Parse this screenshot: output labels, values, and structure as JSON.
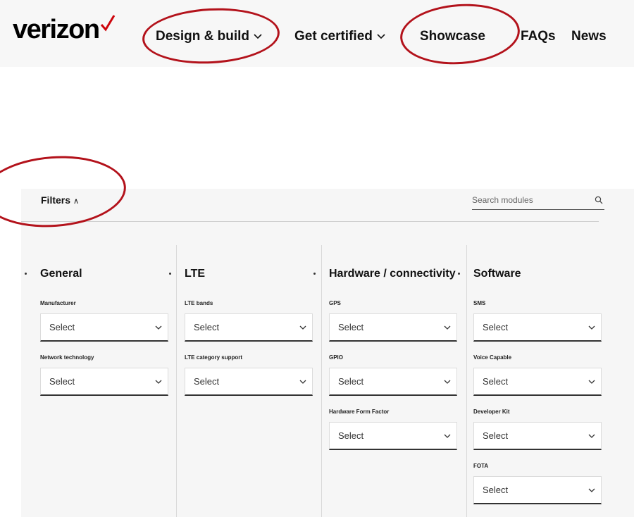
{
  "header": {
    "logo_text": "verizon",
    "nav": [
      {
        "label": "Design & build",
        "has_dropdown": true
      },
      {
        "label": "Get certified",
        "has_dropdown": true
      },
      {
        "label": "Showcase",
        "has_dropdown": false
      },
      {
        "label": "FAQs",
        "has_dropdown": false
      },
      {
        "label": "News",
        "has_dropdown": false
      }
    ]
  },
  "filters": {
    "toggle_label": "Filters",
    "search": {
      "placeholder": "Search modules",
      "value": ""
    },
    "columns": [
      {
        "title": "General",
        "fields": [
          {
            "label": "Manufacturer",
            "value": "Select"
          },
          {
            "label": "Network technology",
            "value": "Select"
          }
        ]
      },
      {
        "title": "LTE",
        "fields": [
          {
            "label": "LTE bands",
            "value": "Select"
          },
          {
            "label": "LTE category support",
            "value": "Select"
          }
        ]
      },
      {
        "title": "Hardware / connectivity",
        "fields": [
          {
            "label": "GPS",
            "value": "Select"
          },
          {
            "label": "GPIO",
            "value": "Select"
          },
          {
            "label": "Hardware Form Factor",
            "value": "Select"
          }
        ]
      },
      {
        "title": "Software",
        "fields": [
          {
            "label": "SMS",
            "value": "Select"
          },
          {
            "label": "Voice Capable",
            "value": "Select"
          },
          {
            "label": "Developer Kit",
            "value": "Select"
          },
          {
            "label": "FOTA",
            "value": "Select"
          }
        ]
      }
    ]
  },
  "colors": {
    "brand_red": "#cd040b",
    "annotation_red": "#b3121b",
    "panel_bg": "#f6f6f6",
    "header_bg": "#f7f7f7"
  },
  "icons": {
    "logo_mark": "checkmark-icon",
    "dropdown": "chevron-down-icon",
    "filters_toggle": "caret-up-icon",
    "search": "search-icon"
  }
}
